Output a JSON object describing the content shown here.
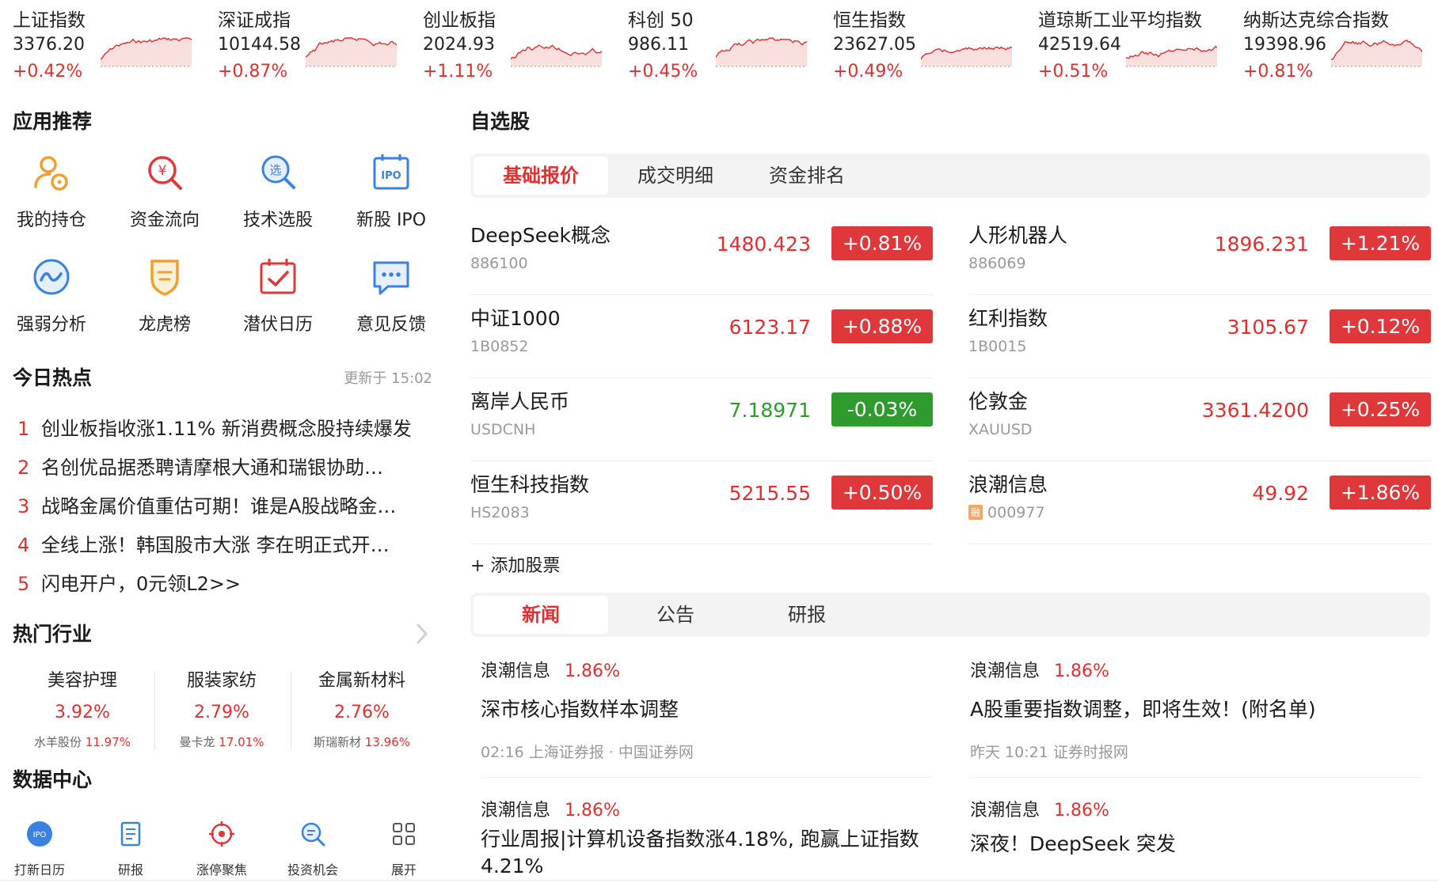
{
  "indices": [
    {
      "name": "上证指数",
      "value": "3376.20",
      "change": "+0.42%",
      "dir": "up"
    },
    {
      "name": "深证成指",
      "value": "10144.58",
      "change": "+0.87%",
      "dir": "up"
    },
    {
      "name": "创业板指",
      "value": "2024.93",
      "change": "+1.11%",
      "dir": "up"
    },
    {
      "name": "科创 50",
      "value": "986.11",
      "change": "+0.45%",
      "dir": "up"
    },
    {
      "name": "恒生指数",
      "value": "23627.05",
      "change": "+0.49%",
      "dir": "up"
    },
    {
      "name": "道琼斯工业平均指数",
      "value": "42519.64",
      "change": "+0.51%",
      "dir": "up"
    },
    {
      "name": "纳斯达克综合指数",
      "value": "19398.96",
      "change": "+0.81%",
      "dir": "up"
    }
  ],
  "apps": {
    "title": "应用推荐",
    "items": [
      {
        "label": "我的持仓",
        "icon": "holdings-icon"
      },
      {
        "label": "资金流向",
        "icon": "money-flow-icon"
      },
      {
        "label": "技术选股",
        "icon": "stock-pick-icon"
      },
      {
        "label": "新股 IPO",
        "icon": "ipo-icon"
      },
      {
        "label": "强弱分析",
        "icon": "strength-analysis-icon"
      },
      {
        "label": "龙虎榜",
        "icon": "dragon-tiger-icon"
      },
      {
        "label": "潜伏日历",
        "icon": "calendar-icon"
      },
      {
        "label": "意见反馈",
        "icon": "feedback-icon"
      }
    ]
  },
  "hot": {
    "title": "今日热点",
    "updated": "更新于 15:02",
    "items": [
      {
        "rank": "1",
        "text": "创业板指收涨1.11% 新消费概念股持续爆发"
      },
      {
        "rank": "2",
        "text": "名创优品据悉聘请摩根大通和瑞银协助…"
      },
      {
        "rank": "3",
        "text": "战略金属价值重估可期！谁是A股战略金…"
      },
      {
        "rank": "4",
        "text": "全线上涨！韩国股市大涨 李在明正式开…"
      },
      {
        "rank": "5",
        "text": "闪电开户，0元领L2>>"
      }
    ]
  },
  "industries": {
    "title": "热门行业",
    "items": [
      {
        "name": "美容护理",
        "pct": "3.92%",
        "stock": "水羊股份",
        "stock_pct": "11.97%"
      },
      {
        "name": "服装家纺",
        "pct": "2.79%",
        "stock": "曼卡龙",
        "stock_pct": "17.01%"
      },
      {
        "name": "金属新材料",
        "pct": "2.76%",
        "stock": "斯瑞新材",
        "stock_pct": "13.96%"
      }
    ]
  },
  "data_center": {
    "title": "数据中心",
    "items": [
      {
        "label": "打新日历",
        "icon": "ipo-badge-icon"
      },
      {
        "label": "研报",
        "icon": "report-icon"
      },
      {
        "label": "涨停聚焦",
        "icon": "target-icon"
      },
      {
        "label": "投资机会",
        "icon": "search-opportunity-icon"
      },
      {
        "label": "展开",
        "icon": "grid-icon"
      }
    ]
  },
  "watchlist": {
    "title": "自选股",
    "tabs": [
      "基础报价",
      "成交明细",
      "资金排名"
    ],
    "active_tab": "基础报价",
    "stocks": [
      {
        "name": "DeepSeek概念",
        "code": "886100",
        "price": "1480.423",
        "change": "+0.81%",
        "dir": "up"
      },
      {
        "name": "人形机器人",
        "code": "886069",
        "price": "1896.231",
        "change": "+1.21%",
        "dir": "up"
      },
      {
        "name": "中证1000",
        "code": "1B0852",
        "price": "6123.17",
        "change": "+0.88%",
        "dir": "up"
      },
      {
        "name": "红利指数",
        "code": "1B0015",
        "price": "3105.67",
        "change": "+0.12%",
        "dir": "up"
      },
      {
        "name": "离岸人民币",
        "code": "USDCNH",
        "price": "7.18971",
        "change": "-0.03%",
        "dir": "down"
      },
      {
        "name": "伦敦金",
        "code": "XAUUSD",
        "price": "3361.4200",
        "change": "+0.25%",
        "dir": "up"
      },
      {
        "name": "恒生科技指数",
        "code": "HS2083",
        "price": "5215.55",
        "change": "+0.50%",
        "dir": "up"
      },
      {
        "name": "浪潮信息",
        "code": "000977",
        "tag": "融",
        "price": "49.92",
        "change": "+1.86%",
        "dir": "up"
      }
    ],
    "add_label": "+ 添加股票"
  },
  "news": {
    "tabs": [
      "新闻",
      "公告",
      "研报"
    ],
    "active_tab": "新闻",
    "items": [
      {
        "stock": "浪潮信息",
        "pct": "1.86%",
        "title": "深市核心指数样本调整",
        "meta": "02:16   上海证券报 · 中国证券网"
      },
      {
        "stock": "浪潮信息",
        "pct": "1.86%",
        "title": "A股重要指数调整，即将生效！(附名单)",
        "meta": "昨天 10:21   证券时报网"
      },
      {
        "stock": "浪潮信息",
        "pct": "1.86%",
        "title": "行业周报|计算机设备指数涨4.18%, 跑赢上证指数4.21%",
        "meta": ""
      },
      {
        "stock": "浪潮信息",
        "pct": "1.86%",
        "title": "深夜！DeepSeek 突发",
        "meta": ""
      }
    ]
  },
  "colors": {
    "up": "#e02f2f",
    "down": "#2f9b2f",
    "accent": "#e02f2f"
  }
}
